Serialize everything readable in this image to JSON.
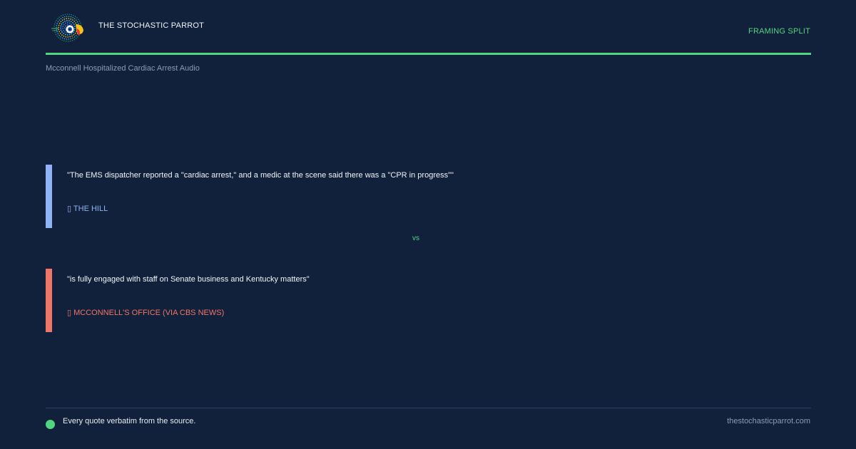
{
  "header": {
    "brand": "THE STOCHASTIC PARROT",
    "label": "FRAMING SPLIT"
  },
  "headline": "Mcconnell Hospitalized Cardiac Arrest Audio",
  "quotes": [
    {
      "text": "\"The EMS dispatcher reported a \"cardiac arrest,\" and a medic at the scene said there was a \"CPR in progress\"\"",
      "source": "▯ THE HILL",
      "color": "#8fb3f5"
    },
    {
      "text": "\"is fully engaged with staff on Senate business and Kentucky matters\"",
      "source": "▯ MCCONNELL'S OFFICE (VIA CBS NEWS)",
      "color": "#ef7567"
    }
  ],
  "divider": "vs",
  "footer": {
    "note": "Every quote verbatim from the source.",
    "site": "thestochasticparrot.com"
  },
  "colors": {
    "background": "#12213b",
    "accent": "#4fd67e",
    "quote_one": "#8fb3f5",
    "quote_two": "#ef7567"
  },
  "icons": {
    "logo": "parrot-logo-icon",
    "footer": "status-dot-icon"
  }
}
